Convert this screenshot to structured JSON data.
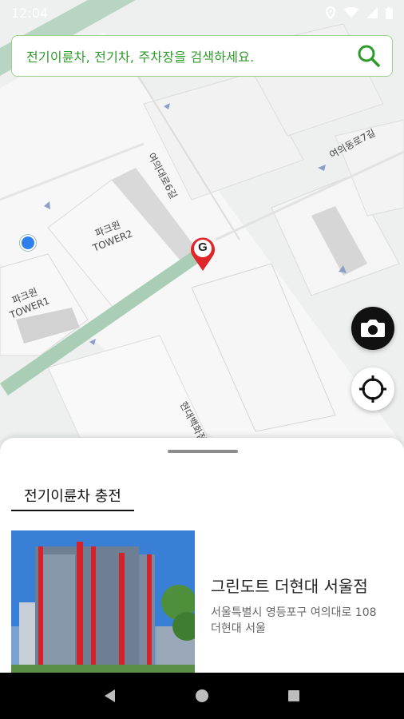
{
  "status_bar": {
    "time": "12:04"
  },
  "search": {
    "placeholder": "전기이륜차, 전기차, 주차장을 검색하세요."
  },
  "map": {
    "labels": {
      "tower2": "파크원\nTOWER2",
      "tower1": "파크원\nTOWER1",
      "road_6": "여의대로6길",
      "road_7": "여의동로7길",
      "hyundai": "현대백화점"
    },
    "marker_letter": "G"
  },
  "sheet": {
    "tab_label": "전기이륜차 충전",
    "place": {
      "name": "그린도트 더현대 서울점",
      "address": "서울특별시 영등포구 여의대로 108 더현대 서울"
    }
  },
  "colors": {
    "accent": "#2e9a2a",
    "search_border": "#9cd28e",
    "marker": "#e0262a"
  }
}
